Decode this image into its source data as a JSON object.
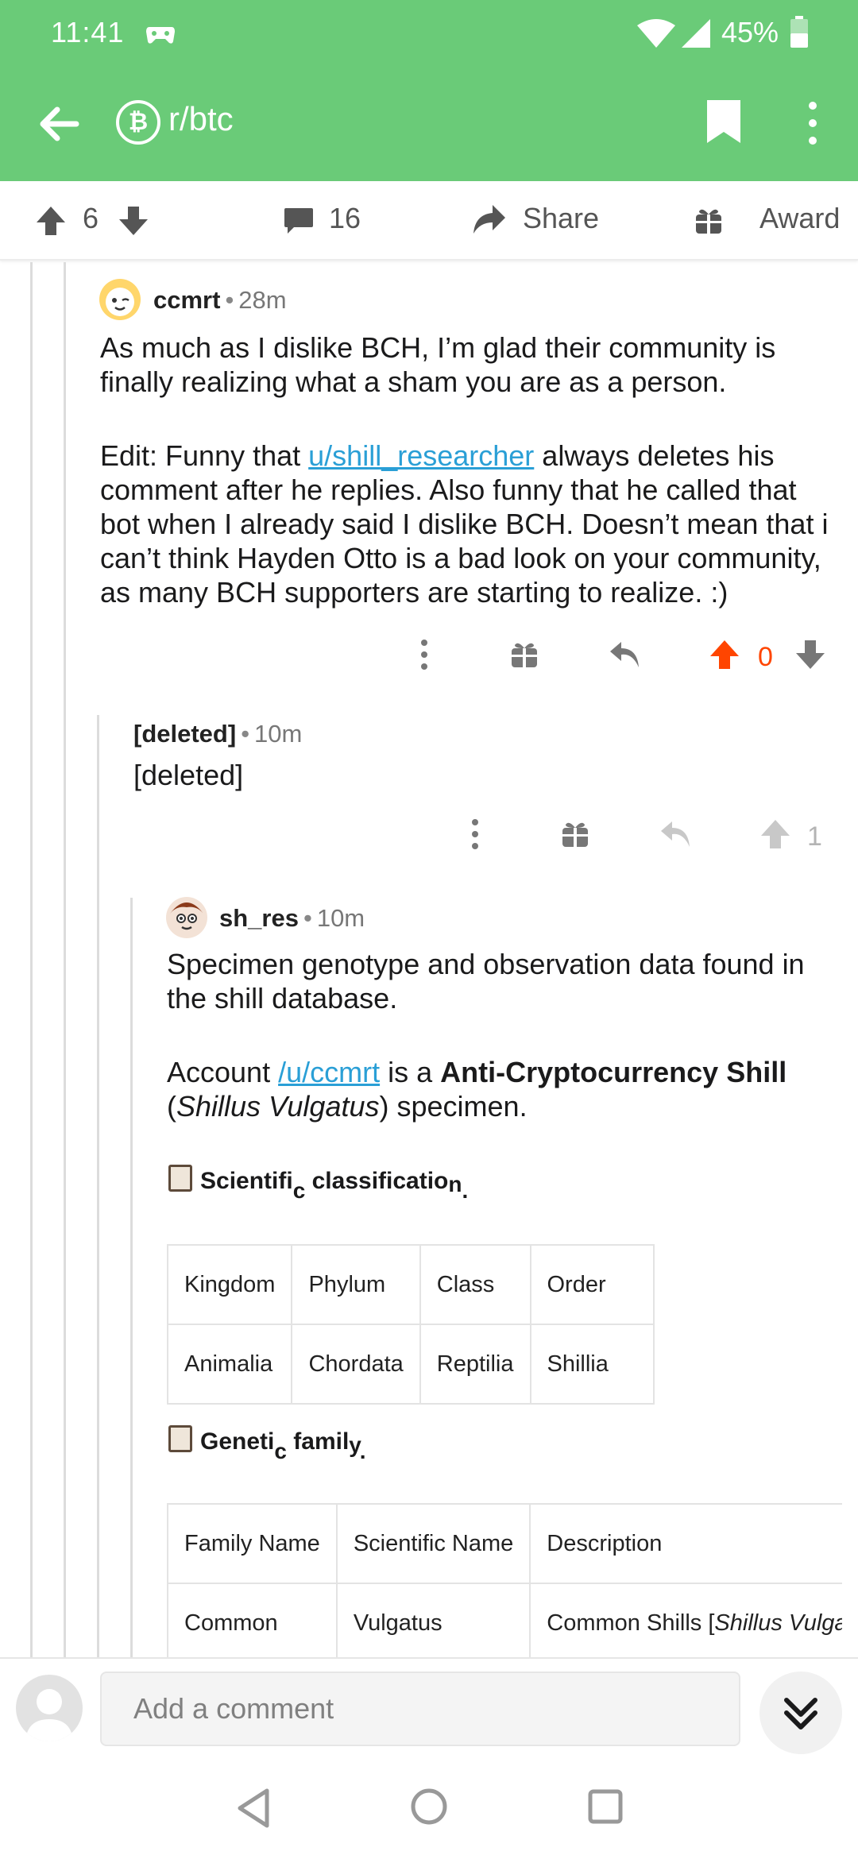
{
  "status": {
    "time": "11:41",
    "battery": "45%"
  },
  "appbar": {
    "subreddit": "r/btc",
    "subreddit_icon": "₿"
  },
  "post_actions": {
    "score": "6",
    "comments": "16",
    "share": "Share",
    "award": "Award"
  },
  "comments": [
    {
      "user": "ccmrt",
      "age": "28m",
      "para1": "As much as I dislike BCH, I’m glad their community is finally realizing what a sham you are as a person.",
      "para2_prefix": "Edit: Funny that ",
      "para2_link": "u/shill_researcher",
      "para2_suffix": " always deletes his comment after he replies. Also funny that he called that bot when I already said I dislike BCH. Doesn’t mean that i can’t think Hayden Otto is a bad look on your community, as many BCH supporters are starting to realize. :)",
      "score": "0"
    },
    {
      "user": "[deleted]",
      "age": "10m",
      "body": "[deleted]",
      "score": "1"
    },
    {
      "user": "sh_res",
      "age": "10m",
      "para1": "Specimen genotype and observation data found in the shill database.",
      "para2_prefix": "Account ",
      "para2_link": "/u/ccmrt",
      "para2_mid": " is a ",
      "para2_bold": "Anti-Cryptocurrency Shill",
      "para2_open": " (",
      "para2_italic": "Shillus Vulgatus",
      "para2_suffix": ") specimen.",
      "section1": {
        "a": "Scientifi",
        "b": "c",
        "c": " classificatio",
        "d": "n",
        "e": "."
      },
      "table1": {
        "header": [
          "Kingdom",
          "Phylum",
          "Class",
          "Order"
        ],
        "row": [
          "Animalia",
          "Chordata",
          "Reptilia",
          "Shillia"
        ]
      },
      "section2": {
        "a": "Geneti",
        "b": "c",
        "c": " famil",
        "d": "y",
        "e": "."
      },
      "table2": {
        "header": [
          "Family Name",
          "Scientific Name",
          "Description"
        ],
        "row_a": "Common",
        "row_b": "Vulgatus",
        "row_c_prefix": "Common Shills [",
        "row_c_italic": "Shillus Vulga"
      }
    }
  ],
  "comment_input": {
    "placeholder": "Add a comment"
  },
  "colors": {
    "header": "#6acb78",
    "upvoted": "#ff4500",
    "link": "#2a9fd6"
  },
  "icons": [
    "back-arrow-icon",
    "bitcoin-icon",
    "bookmark-icon",
    "more-vert-icon",
    "upvote-icon",
    "downvote-icon",
    "comment-icon",
    "share-icon",
    "gift-icon",
    "reply-icon",
    "clipboard-icon",
    "double-chevron-down-icon"
  ]
}
